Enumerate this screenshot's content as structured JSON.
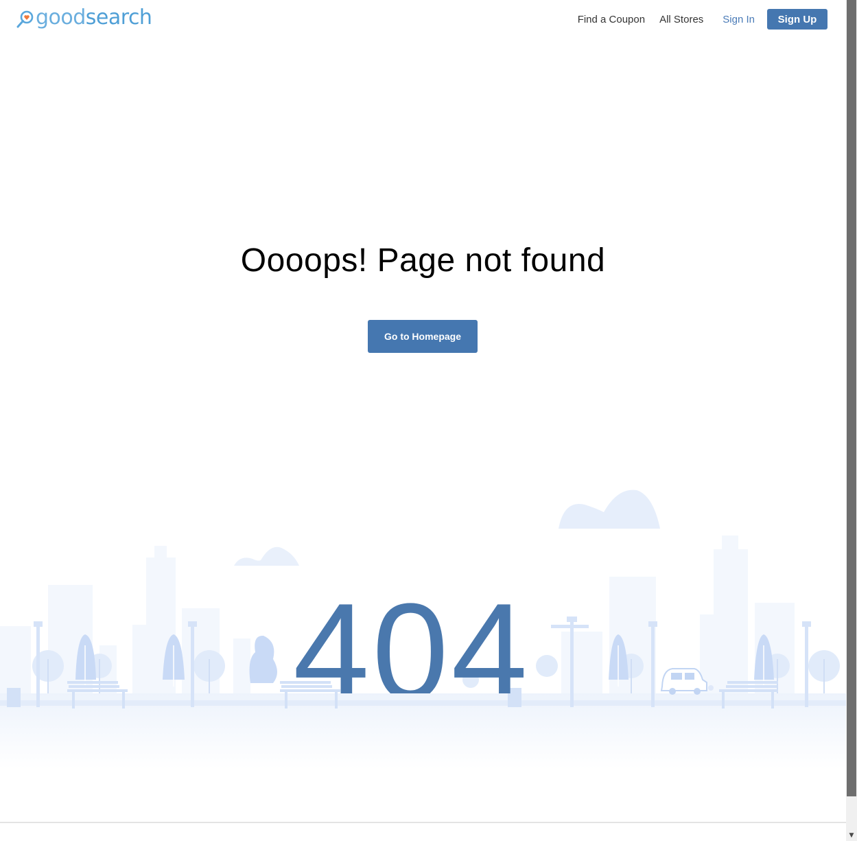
{
  "header": {
    "logo": {
      "part1": "good",
      "part2": "search",
      "icon": "magnifier-heart-icon"
    },
    "nav": {
      "find_coupon": "Find a Coupon",
      "all_stores": "All Stores",
      "sign_in": "Sign In",
      "sign_up": "Sign Up"
    }
  },
  "main": {
    "title": "Oooops! Page not found",
    "home_button": "Go to Homepage",
    "error_code": "404"
  },
  "colors": {
    "brand_blue": "#4577b0",
    "logo_blue": "#5aa7dc",
    "illustration_light": "#e9f0fb",
    "illustration_mid": "#c8d9f5"
  },
  "scrollbar": {
    "up_icon": "arrow-up-icon",
    "down_icon": "arrow-down-icon"
  }
}
